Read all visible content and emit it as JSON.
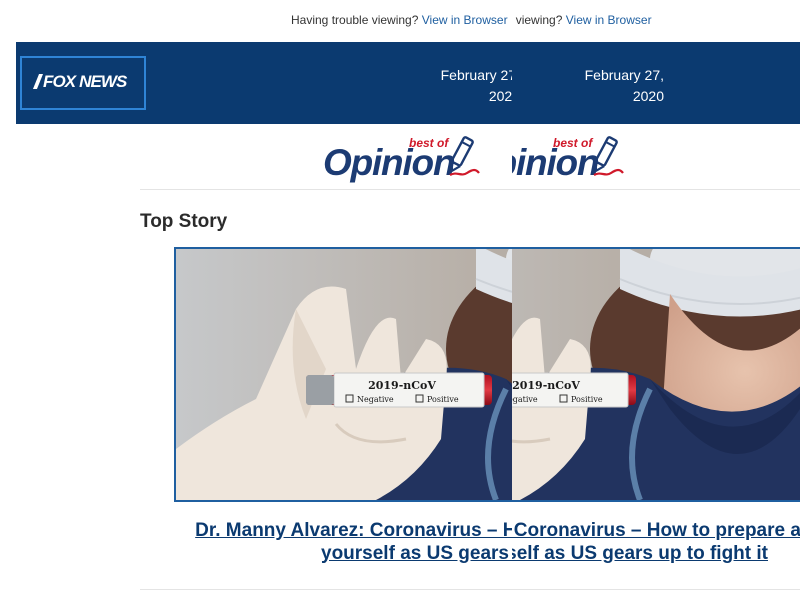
{
  "preheader": {
    "text": "Having trouble viewing?",
    "link_label": "View in Browser"
  },
  "header": {
    "logo_text": "FOX NEWS",
    "date": "February 27, 2020"
  },
  "brand": {
    "opinion_word": "Opinion",
    "best_of": "best of"
  },
  "section": {
    "title": "Top Story"
  },
  "story": {
    "image_labels": {
      "tube_label": "2019-nCoV",
      "option_negative": "Negative",
      "option_positive": "Positive"
    },
    "headline": "Dr. Manny Alvarez: Coronavirus – How to prepare and protect yourself as US gears up to fight it"
  },
  "colors": {
    "header_background": "#0b3a70",
    "logo_border": "#2f84d6",
    "link": "#1f5fa0",
    "headline": "#0b3a70",
    "best_of_red": "#d0192a"
  },
  "icons": {
    "pen": "pen-icon"
  }
}
